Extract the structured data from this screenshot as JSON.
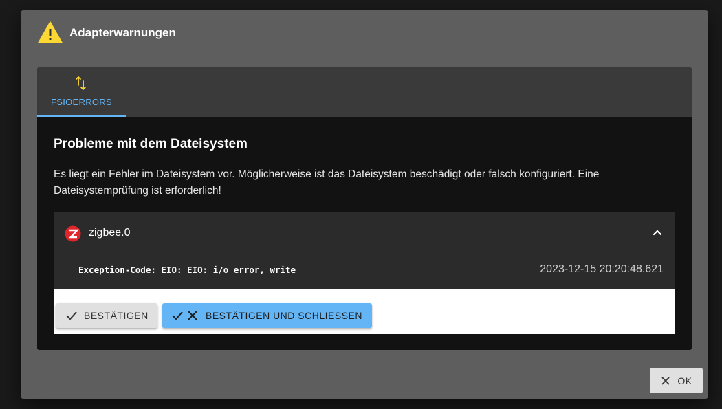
{
  "dialog": {
    "title": "Adapterwarnungen",
    "title_icon": "warning-triangle-icon"
  },
  "tabs": [
    {
      "label": "FSIOERRORS",
      "icon": "swap-vertical-icon",
      "active": true
    }
  ],
  "section": {
    "title": "Probleme mit dem Dateisystem",
    "description": "Es liegt ein Fehler im Dateisystem vor. Möglicherweise ist das Dateisystem beschädigt oder falsch konfiguriert. Eine Dateisystemprüfung ist erforderlich!"
  },
  "entry": {
    "name": "zigbee.0",
    "logo": "zigbee-logo-icon",
    "message": "Exception-Code: EIO: EIO: i/o error, write",
    "timestamp": "2023-12-15 20:20:48.621"
  },
  "actions": {
    "confirm_label": "BESTÄTIGEN",
    "confirm_close_label": "BESTÄTIGEN UND SCHLIESSEN"
  },
  "footer": {
    "ok_label": "OK"
  },
  "colors": {
    "accent": "#64b5f6",
    "warning": "#fdd835",
    "zigbee_red": "#e0262a"
  }
}
